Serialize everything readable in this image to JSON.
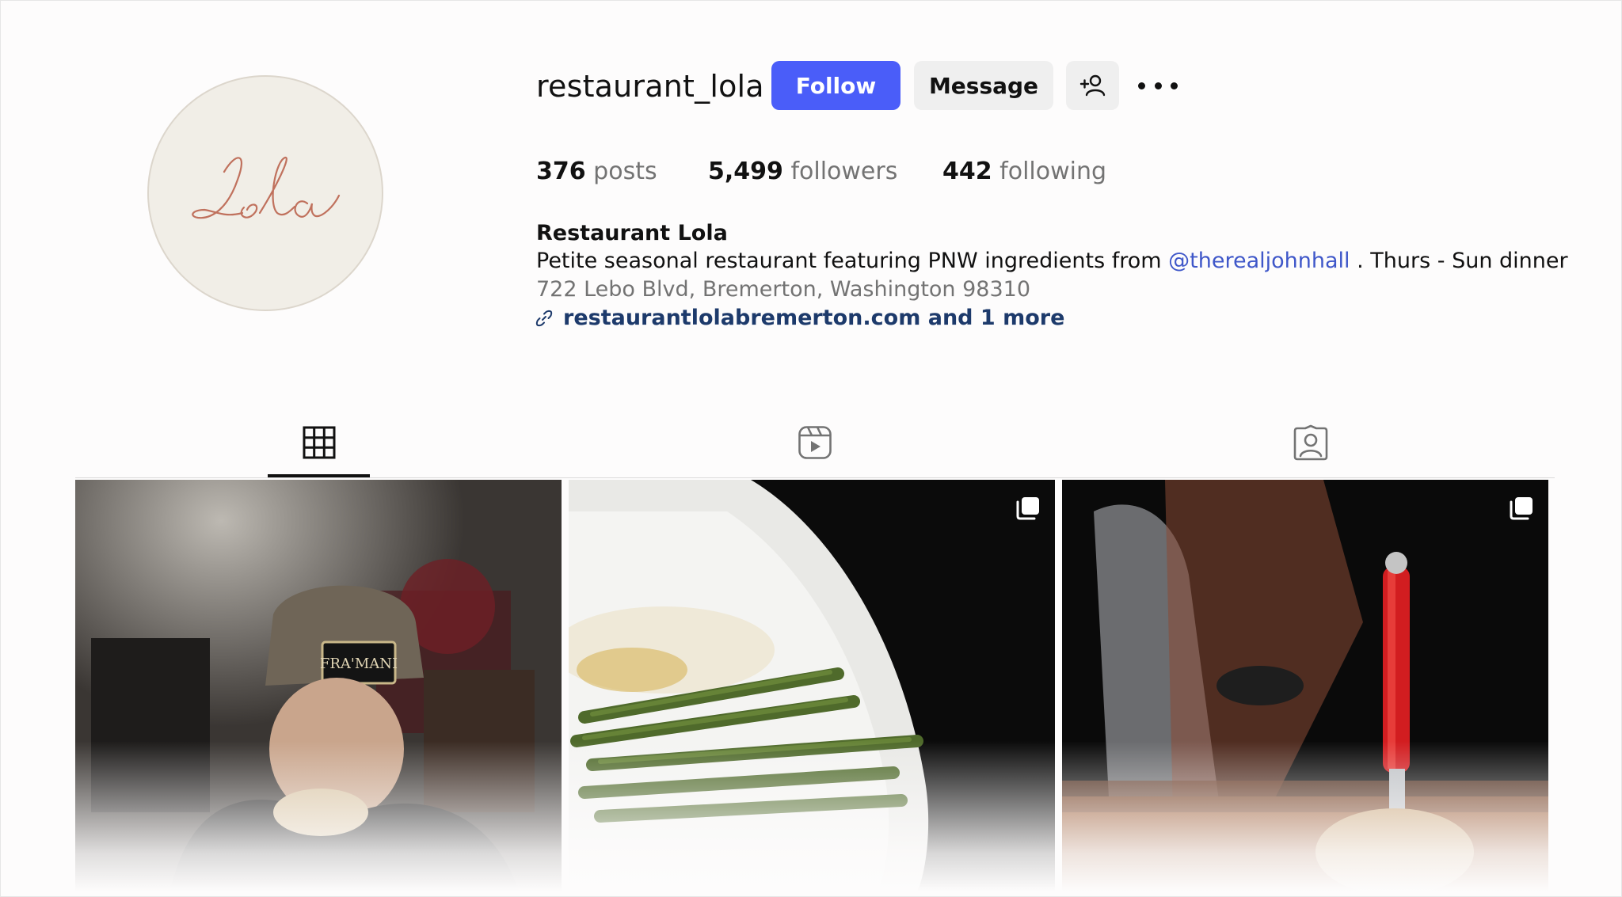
{
  "profile": {
    "username": "restaurant_lola",
    "avatar_text": "Lola",
    "colors": {
      "accent": "#4a5df9",
      "secondary_btn": "#efefef",
      "mention": "#3f57c9",
      "link": "#1d3a6b",
      "avatar_bg": "#f1eee7",
      "avatar_script": "#c0715d"
    }
  },
  "actions": {
    "follow_label": "Follow",
    "message_label": "Message",
    "add_user_icon": "person-plus-icon",
    "more_icon": "more-horizontal-icon"
  },
  "stats": {
    "posts_count": "376",
    "posts_label": "posts",
    "followers_count": "5,499",
    "followers_label": "followers",
    "following_count": "442",
    "following_label": "following"
  },
  "bio": {
    "name": "Restaurant Lola",
    "text_before": "Petite seasonal restaurant featuring PNW ingredients from ",
    "mention": "@therealjohnhall",
    "text_after": " . Thurs - Sun dinner",
    "address": "722 Lebo Blvd, Bremerton, Washington 98310",
    "link_icon": "link-icon",
    "link_text": "restaurantlolabremerton.com and 1 more"
  },
  "tabs": [
    {
      "name": "posts",
      "icon": "grid-icon",
      "active": true
    },
    {
      "name": "reels",
      "icon": "reels-icon",
      "active": false
    },
    {
      "name": "tagged",
      "icon": "tagged-icon",
      "active": false
    }
  ],
  "posts": [
    {
      "subject": "man in cap eating sandwich",
      "carousel": false
    },
    {
      "subject": "asparagus plate",
      "carousel": true
    },
    {
      "subject": "red knife in bread",
      "carousel": true
    }
  ]
}
